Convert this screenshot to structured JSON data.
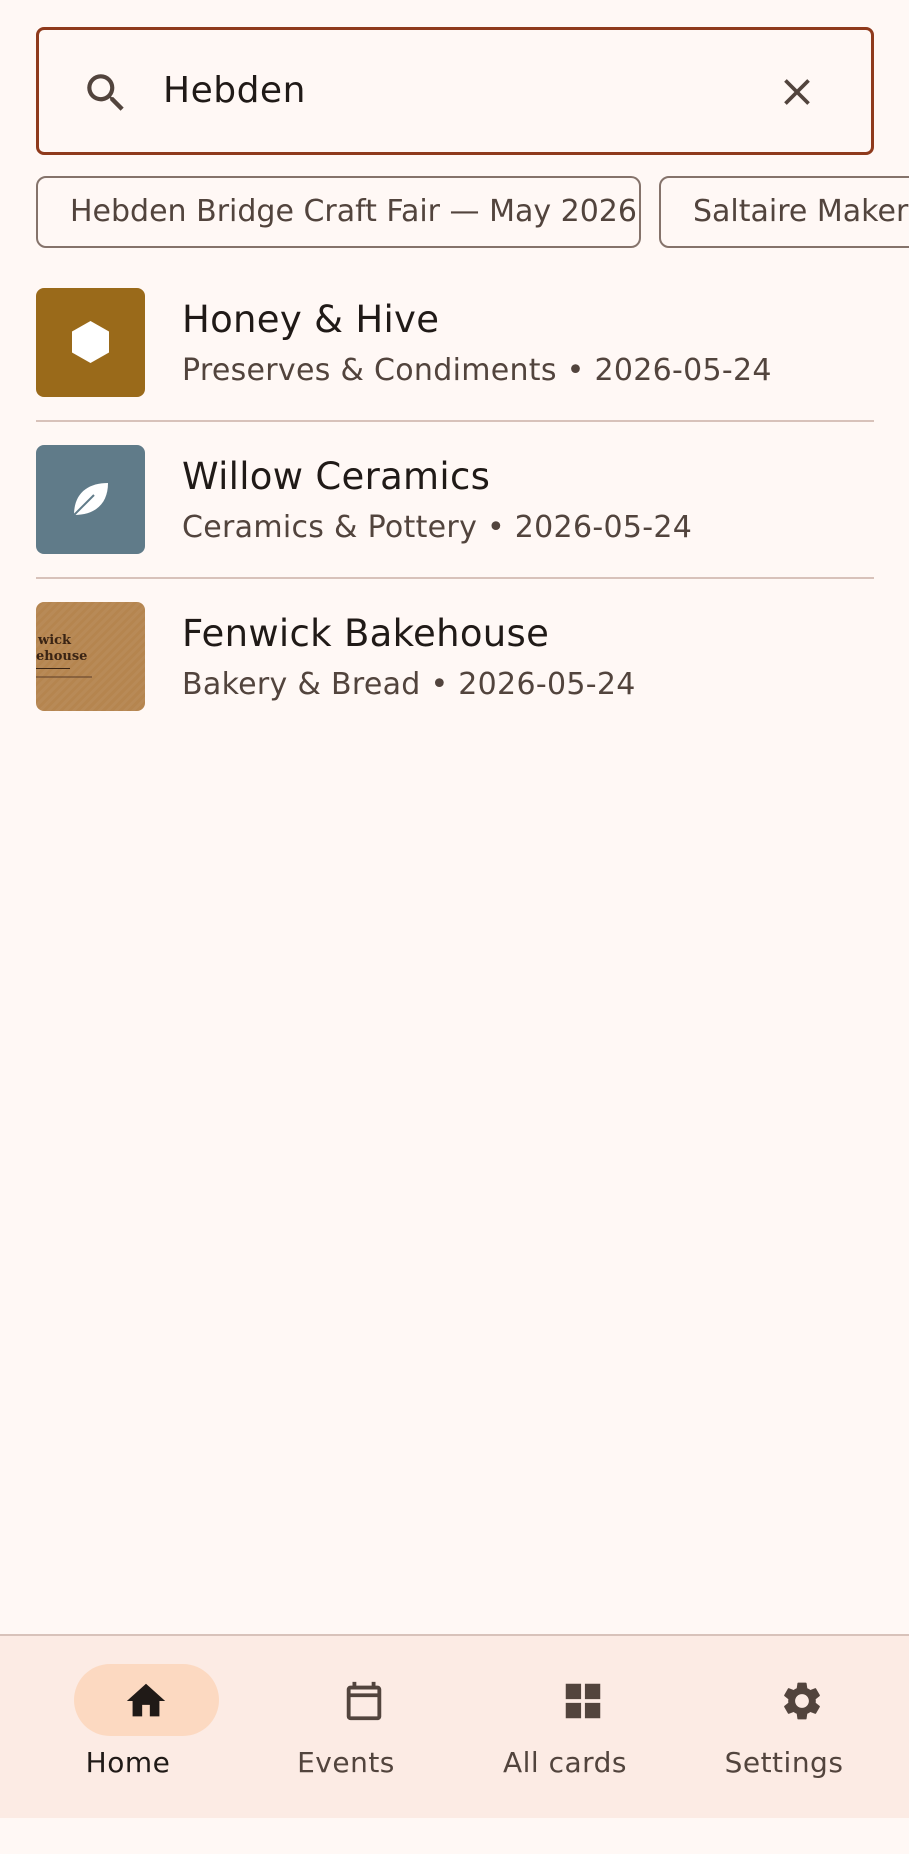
{
  "search": {
    "query": "Hebden",
    "accent": "#8f3a1c"
  },
  "chips": [
    {
      "label": "Hebden Bridge Craft Fair — May 2026"
    },
    {
      "label": "Saltaire Maker"
    }
  ],
  "results": [
    {
      "name": "Honey & Hive",
      "category": "Preserves & Condiments",
      "date": "2026-05-24",
      "subtitle": "Preserves & Condiments • 2026-05-24",
      "thumb": {
        "color": "#9a6a1a",
        "icon": "hexagon-icon"
      }
    },
    {
      "name": "Willow Ceramics",
      "category": "Ceramics & Pottery",
      "date": "2026-05-24",
      "subtitle": "Ceramics & Pottery • 2026-05-24",
      "thumb": {
        "color": "#607b89",
        "icon": "leaf-icon"
      }
    },
    {
      "name": "Fenwick Bakehouse",
      "category": "Bakery & Bread",
      "date": "2026-05-24",
      "subtitle": "Bakery & Bread • 2026-05-24",
      "thumb": {
        "color": "#b88a57",
        "image": "business-card-photo",
        "logo_text": [
          "wick",
          "ehouse"
        ]
      }
    }
  ],
  "nav": {
    "items": [
      {
        "label": "Home",
        "icon": "home-icon",
        "active": true
      },
      {
        "label": "Events",
        "icon": "calendar-icon",
        "active": false
      },
      {
        "label": "All cards",
        "icon": "grid-icon",
        "active": false
      },
      {
        "label": "Settings",
        "icon": "gear-icon",
        "active": false
      }
    ]
  },
  "colors": {
    "background": "#fff8f5",
    "nav_background": "#fcebe4",
    "active_pill": "#fcd9c1",
    "text_primary": "#201a17",
    "text_secondary": "#52443d"
  }
}
